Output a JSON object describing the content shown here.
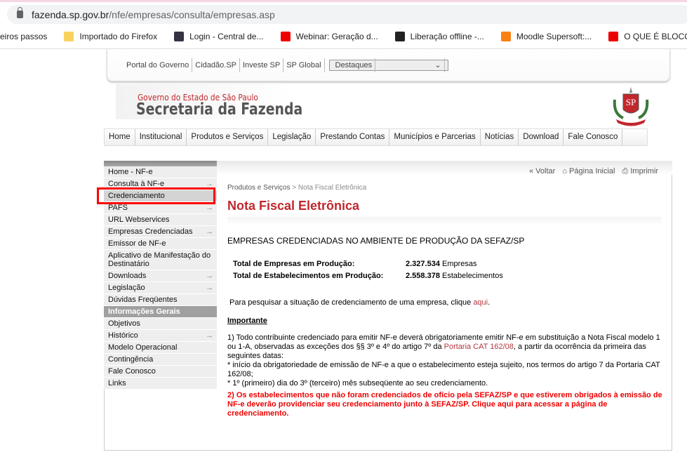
{
  "browser": {
    "url_host": "fazenda.sp.gov.br",
    "url_path": "/nfe/empresas/consulta/empresas.asp",
    "bookmarks": [
      {
        "label": "eiros passos",
        "icon": "none"
      },
      {
        "label": "Importado do Firefox",
        "icon": "folder-icon",
        "color": "#f9d25e"
      },
      {
        "label": "Login - Central de...",
        "icon": "site-icon",
        "color": "#334"
      },
      {
        "label": "Webinar: Geração d...",
        "icon": "youtube-icon",
        "color": "#e00"
      },
      {
        "label": "Liberação offline -...",
        "icon": "globe-icon",
        "color": "#222"
      },
      {
        "label": "Moodle Supersoft:...",
        "icon": "moodle-icon",
        "color": "#f98012"
      },
      {
        "label": "O QUE É BLOCO K |...",
        "icon": "youtube-icon",
        "color": "#e00"
      }
    ]
  },
  "govbar": {
    "links": [
      "Portal do Governo",
      "Cidadão.SP",
      "Investe SP",
      "SP Global"
    ],
    "select": "Destaques"
  },
  "logo": {
    "line1": "Governo do Estado de São Paulo",
    "line2": "Secretaria da Fazenda"
  },
  "nav": [
    "Home",
    "Institucional",
    "Produtos e Serviços",
    "Legislação",
    "Prestando Contas",
    "Municípios e Parcerias",
    "Notícias",
    "Download",
    "Fale Conosco"
  ],
  "sidebar": [
    {
      "label": "Home - NF-e"
    },
    {
      "label": "Consulta à NF-e",
      "arrow": true
    },
    {
      "label": "Credenciamento",
      "selected": true
    },
    {
      "label": "PAFS",
      "arrow": true
    },
    {
      "label": "URL Webservices"
    },
    {
      "label": "Empresas Credenciadas",
      "arrow": true
    },
    {
      "label": "Emissor de NF-e"
    },
    {
      "label": "Aplicativo de Manifestação do Destinatário"
    },
    {
      "label": "Downloads",
      "arrow": true
    },
    {
      "label": "Legislação",
      "arrow": true
    },
    {
      "label": "Dúvidas Freqüentes"
    },
    {
      "label": "Informações Gerais",
      "header": true
    },
    {
      "label": "Objetivos"
    },
    {
      "label": "Histórico",
      "arrow": true
    },
    {
      "label": "Modelo Operacional"
    },
    {
      "label": "Contingência"
    },
    {
      "label": "Fale Conosco"
    },
    {
      "label": "Links"
    }
  ],
  "tools": {
    "back": "Voltar",
    "home": "Página Inicial",
    "print": "Imprimir"
  },
  "breadcrumb": {
    "parent": "Produtos e Serviços",
    "sep": " > ",
    "current": "Nota Fiscal Eletrônica"
  },
  "title": "Nota Fiscal Eletrônica",
  "heading": "EMPRESAS CREDENCIADAS NO AMBIENTE DE PRODUÇÃO DA SEFAZ/SP",
  "stats": [
    {
      "label": "Total de Empresas em Produção:",
      "value": "2.327.534",
      "unit": "Empresas"
    },
    {
      "label": "Total de Estabelecimentos em Produção:",
      "value": "2.558.378",
      "unit": "Estabelecimentos"
    }
  ],
  "search": {
    "text": "Para pesquisar a situação de credenciamento de uma empresa, clique ",
    "link": "aqui",
    "end": "."
  },
  "important": "Importante",
  "p1": {
    "a": "1) Todo contribuinte credenciado para emitir NF-e deverá obrigatoriamente emitir NF-e em substituição a Nota Fiscal modelo 1 ou 1-A, observadas as exceções dos §§ 3º e 4º do artigo 7º da ",
    "link": "Portaria CAT 162/08",
    "b": ", a partir da ocorrência da primeira das seguintes datas:",
    "l1": "* início da obrigatoriedade de emissão de NF-e a que o estabelecimento esteja sujeito, nos termos do artigo 7 da Portaria CAT 162/08;",
    "l2": "* 1º (primeiro) dia do 3º (terceiro) mês subseqüente ao seu credenciamento."
  },
  "p2": "2) Os estabelecimentos que não foram credenciados de ofício pela SEFAZ/SP e que estiverem obrigados à emissão de NF-e deverão providenciar seu credenciamento junto à SEFAZ/SP. Clique aqui para acessar a página de credenciamento."
}
